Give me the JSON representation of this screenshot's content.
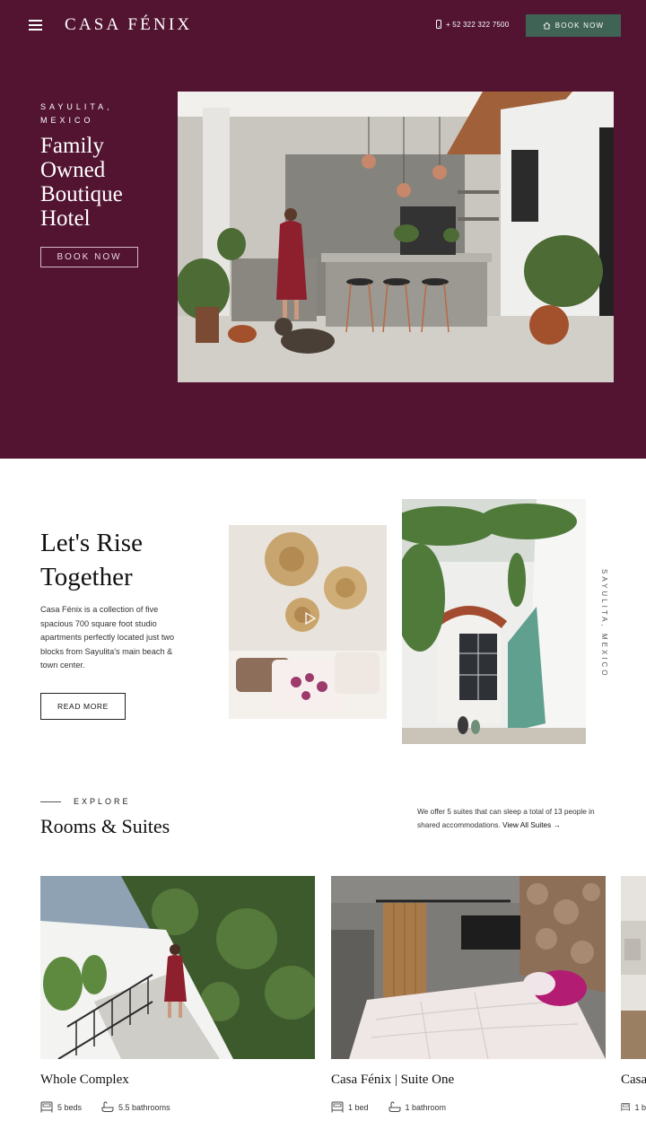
{
  "header": {
    "logo": "CASA FÉNIX",
    "phone": "+ 52 322 322 7500",
    "book_label": "BOOK NOW"
  },
  "hero": {
    "kicker": "SAYULITA, MEXICO",
    "title": "Family Owned Boutique Hotel",
    "book_label": "BOOK NOW"
  },
  "intro": {
    "title": "Let's Rise Together",
    "text": "Casa Fénix is a collection of five spacious 700 square foot studio apartments perfectly located just two blocks from Sayulita's main beach & town center.",
    "read_more": "READ MORE",
    "vertical_text": "SAYULITA, MEXICO"
  },
  "rooms": {
    "kicker": "EXPLORE",
    "title": "Rooms & Suites",
    "description": "We offer 5 suites that can sleep a total of 13 people in shared accommodations.",
    "view_all": "View All Suites →",
    "cards": [
      {
        "name": "Whole Complex",
        "beds": "5 beds",
        "baths": "5.5 bathrooms"
      },
      {
        "name": "Casa Fénix | Suite One",
        "beds": "1 bed",
        "baths": "1 bathroom"
      },
      {
        "name": "Casa",
        "beds": "1 b",
        "baths": ""
      }
    ]
  },
  "colors": {
    "hero_bg": "#521431",
    "accent_button": "#3f6355"
  },
  "icons": [
    "menu-icon",
    "phone-icon",
    "home-icon",
    "play-icon",
    "bed-icon",
    "bath-icon"
  ]
}
